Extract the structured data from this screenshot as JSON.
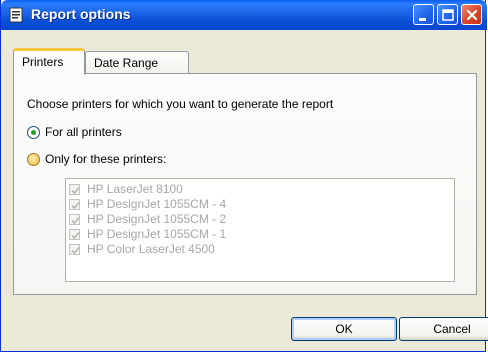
{
  "window": {
    "title": "Report options"
  },
  "title_buttons": {
    "minimize": "minimize-icon",
    "maximize": "maximize-icon",
    "close": "close-icon"
  },
  "tabs": [
    {
      "label": "Printers",
      "selected": true
    },
    {
      "label": "Date Range",
      "selected": false
    }
  ],
  "printers_tab": {
    "instruction": "Choose printers for which you want to generate the report",
    "radio_all": {
      "label": "For all printers",
      "checked": true
    },
    "radio_only": {
      "label": "Only for these printers:",
      "checked": false
    },
    "printers": [
      {
        "label": "HP LaserJet 8100",
        "checked": true
      },
      {
        "label": "HP DesignJet 1055CM - 4",
        "checked": true
      },
      {
        "label": "HP DesignJet 1055CM - 2",
        "checked": true
      },
      {
        "label": "HP DesignJet 1055CM - 1",
        "checked": true
      },
      {
        "label": "HP Color LaserJet 4500",
        "checked": true
      }
    ]
  },
  "buttons": {
    "ok": "OK",
    "cancel": "Cancel"
  },
  "colors": {
    "titlebar": "#0b4fd6",
    "window_bg": "#ece9d8",
    "tab_highlight": "#ffc83c",
    "disabled_text": "#a7a6aa"
  }
}
